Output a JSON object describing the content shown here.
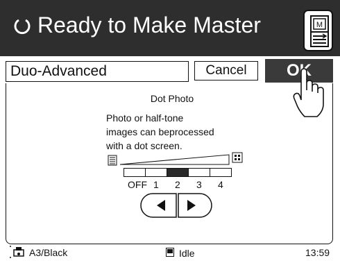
{
  "header": {
    "title": "Ready to Make Master",
    "title_icon": "power-standby-icon",
    "master_button_icon": "master-making-icon",
    "master_button_letter": "M"
  },
  "mode_row": {
    "mode_label": "Duo-Advanced",
    "cancel_label": "Cancel",
    "ok_label": "OK"
  },
  "dot_photo": {
    "title": "Dot Photo",
    "description_lines": [
      "Photo or half-tone",
      "images can beprocessed",
      "with a dot screen."
    ],
    "levels": [
      "OFF",
      "1",
      "2",
      "3",
      "4"
    ],
    "selected_level": "2",
    "low_density_icon": "fine-dot-icon",
    "high_density_icon": "coarse-dot-icon"
  },
  "controls": {
    "decrease_icon": "left-arrow-icon",
    "increase_icon": "right-arrow-icon"
  },
  "status": {
    "paper": "A3/Black",
    "state": "Idle",
    "time": "13:59"
  },
  "colors": {
    "header_bg": "#2e2e2e",
    "ok_bg": "#3a3a3a",
    "text": "#111111"
  }
}
